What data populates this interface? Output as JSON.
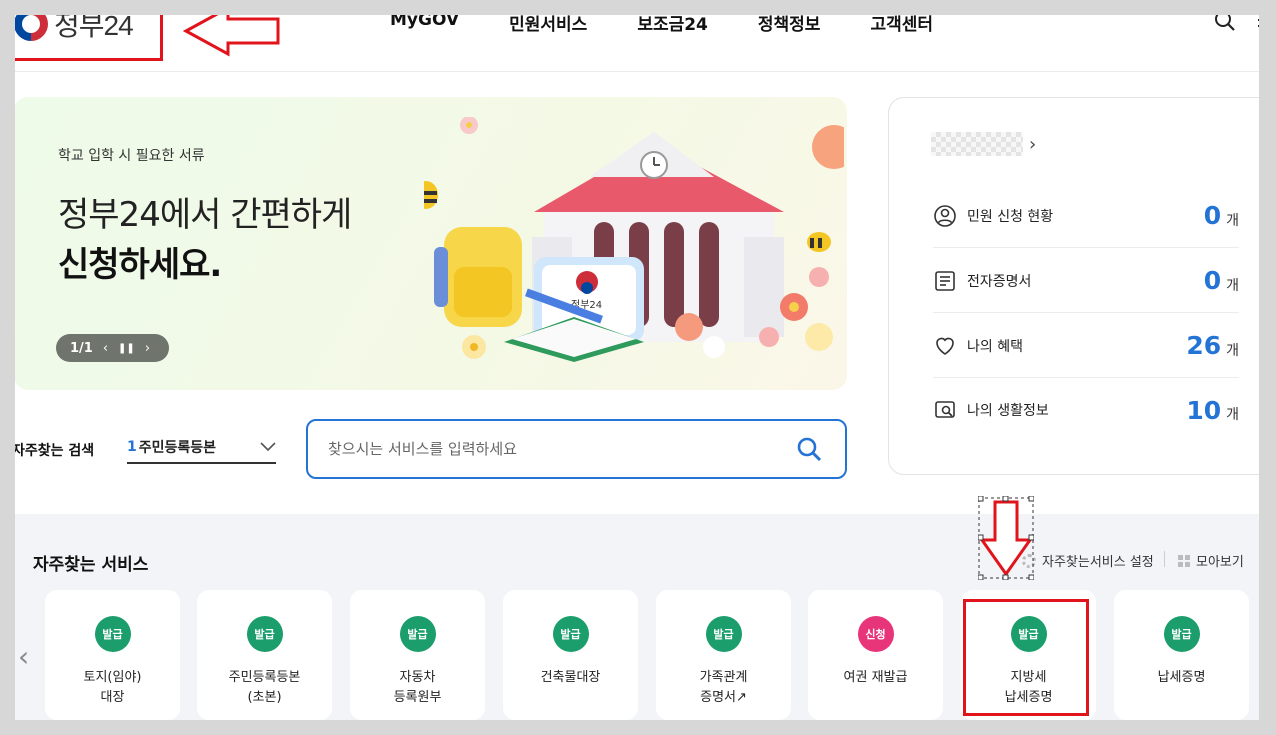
{
  "header": {
    "logo_text": "정부24",
    "nav": [
      "MyGOV",
      "민원서비스",
      "보조금24",
      "정책정보",
      "고객센터"
    ]
  },
  "banner": {
    "subtitle": "학교 입학 시 필요한 서류",
    "title_line1": "정부24에서 간편하게",
    "title_line2": "신청하세요.",
    "pager": "1/1",
    "book_label": "정부24"
  },
  "user_card": {
    "stats": [
      {
        "label": "민원 신청 현황",
        "count": "0",
        "unit": "개",
        "icon": "person-circle-icon"
      },
      {
        "label": "전자증명서",
        "count": "0",
        "unit": "개",
        "icon": "document-icon"
      },
      {
        "label": "나의 혜택",
        "count": "26",
        "unit": "개",
        "icon": "heart-icon"
      },
      {
        "label": "나의 생활정보",
        "count": "10",
        "unit": "개",
        "icon": "search-doc-icon"
      }
    ]
  },
  "frequent_search": {
    "label": "자주찾는 검색",
    "rank": "1",
    "value": "주민등록등본"
  },
  "search": {
    "placeholder": "찾으시는 서비스를 입력하세요"
  },
  "services": {
    "title": "자주찾는 서비스",
    "setting_label": "자주찾는서비스 설정",
    "view_all_label": "모아보기",
    "tiles": [
      {
        "badge": "발급",
        "label": "토지(임야)\n대장",
        "color": "#1b9e6b"
      },
      {
        "badge": "발급",
        "label": "주민등록등본\n(초본)",
        "color": "#1b9e6b"
      },
      {
        "badge": "발급",
        "label": "자동차\n등록원부",
        "color": "#1b9e6b"
      },
      {
        "badge": "발급",
        "label": "건축물대장",
        "color": "#1b9e6b"
      },
      {
        "badge": "발급",
        "label": "가족관계\n증명서↗",
        "color": "#1b9e6b"
      },
      {
        "badge": "신청",
        "label": "여권 재발급",
        "color": "#e8357a"
      },
      {
        "badge": "발급",
        "label": "지방세\n납세증명",
        "color": "#1b9e6b"
      },
      {
        "badge": "발급",
        "label": "납세증명",
        "color": "#1b9e6b"
      }
    ]
  },
  "colors": {
    "accent": "#2474d6",
    "annotation": "#e1141c"
  }
}
